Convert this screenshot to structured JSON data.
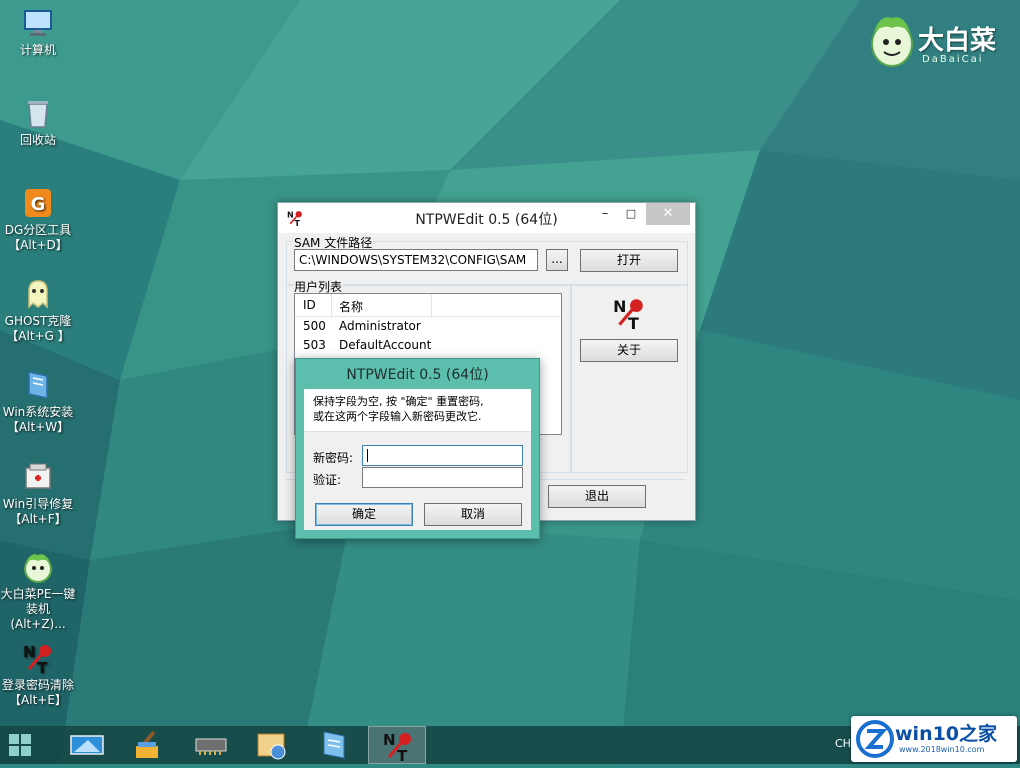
{
  "desktop_icons": [
    {
      "label": "计算机",
      "icon": "computer-icon"
    },
    {
      "label": "回收站",
      "icon": "recycle-bin-icon"
    },
    {
      "label": "DG分区工具\n【Alt+D】",
      "icon": "diskgenius-icon"
    },
    {
      "label": "GHOST克隆\n【Alt+G 】",
      "icon": "ghost-icon"
    },
    {
      "label": "Win系统安装\n【Alt+W】",
      "icon": "windows-install-icon"
    },
    {
      "label": "Win引导修复\n【Alt+F】",
      "icon": "boot-repair-icon"
    },
    {
      "label": "大白菜PE一键\n装机(Alt+Z)...",
      "icon": "dabaicai-installer-icon"
    },
    {
      "label": "登录密码清除\n【Alt+E】",
      "icon": "ntpwedit-icon"
    }
  ],
  "brand": {
    "name_cn": "大白菜",
    "name_en": "DaBaiCai"
  },
  "main_window": {
    "title": "NTPWEdit 0.5 (64位)",
    "sam_group_label": "SAM 文件路径",
    "sam_path": "C:\\WINDOWS\\SYSTEM32\\CONFIG\\SAM",
    "browse_label": "...",
    "open_label": "打开",
    "user_list_label": "用户列表",
    "columns": [
      "ID",
      "名称"
    ],
    "users": [
      {
        "id": "500",
        "name": "Administrator"
      },
      {
        "id": "503",
        "name": "DefaultAccount"
      }
    ],
    "about_label": "关于",
    "exit_label": "退出"
  },
  "dialog": {
    "title": "NTPWEdit 0.5 (64位)",
    "message_line1": "保持字段为空, 按 \"确定\" 重置密码,",
    "message_line2": "或在这两个字段输入新密码更改它.",
    "new_password_label": "新密码:",
    "new_password_value": "",
    "verify_label": "验证:",
    "verify_value": "",
    "ok_label": "确定",
    "cancel_label": "取消"
  },
  "taskbar": {
    "items": [
      "start-icon",
      "desktop-icon",
      "cleaner-icon",
      "memory-icon",
      "network-icon",
      "notepad-icon",
      "ntpwedit-icon"
    ],
    "active_item": "ntpwedit-icon",
    "language": "CH"
  },
  "watermark": {
    "main": "win10之家",
    "sub": "www.2018win10.com"
  },
  "colors": {
    "desktop": "#2f8a84",
    "dialog_frame": "#5cbfae",
    "taskbar": "#164848"
  }
}
